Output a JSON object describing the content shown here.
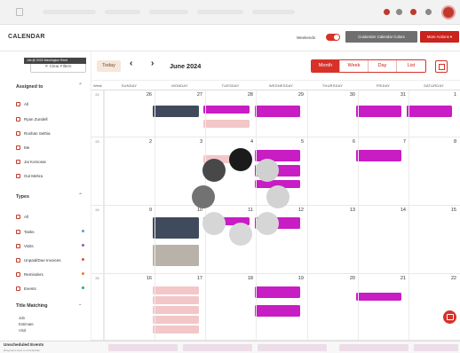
{
  "topbar": {
    "icons": [
      "menu-icon",
      "notification-icon",
      "help-icon",
      "chart-icon",
      "settings-icon",
      "avatar"
    ]
  },
  "header": {
    "title": "CALENDAR",
    "weekends_label": "Weekends",
    "customize_label": "Customize Calendar Colors",
    "more_actions_label": "More Actions ▾"
  },
  "sidebar": {
    "clear_filters": "✕ Clear Filters",
    "assigned_title": "Assigned to",
    "assigned": [
      {
        "label": "All"
      },
      {
        "label": "Ryan Zundell"
      },
      {
        "label": "Roshan Sethia"
      },
      {
        "label": "Me"
      },
      {
        "label": "Jai Komosar"
      },
      {
        "label": "Gul Mehra"
      }
    ],
    "tooltip": "Job @ 2024 Washington Reed",
    "types_title": "Types",
    "types": [
      {
        "label": "All",
        "color": ""
      },
      {
        "label": "Tasks",
        "color": "#4aa3df"
      },
      {
        "label": "Visits",
        "color": "#9b59b6"
      },
      {
        "label": "Unpaid/Due Invoices",
        "color": "#e74c3c"
      },
      {
        "label": "Reminders",
        "color": "#e67e22"
      },
      {
        "label": "Events",
        "color": "#27ae60"
      }
    ],
    "title_matching_title": "Title Matching",
    "title_matching": [
      "Job",
      "Estimate",
      "Visit"
    ]
  },
  "toolbar": {
    "today": "Today",
    "prev": "‹",
    "next": "›",
    "month_title": "June 2024",
    "views": [
      {
        "label": "Month",
        "active": true
      },
      {
        "label": "Week",
        "active": false
      },
      {
        "label": "Day",
        "active": false
      },
      {
        "label": "List",
        "active": false
      }
    ]
  },
  "grid": {
    "week_label": "Week",
    "day_names": [
      "SUNDAY",
      "MONDAY",
      "TUESDAY",
      "WEDNESDAY",
      "THURSDAY",
      "FRIDAY",
      "SATURDAY"
    ],
    "weeks": [
      {
        "num": "22",
        "dates": [
          "26",
          "27",
          "28",
          "29",
          "30",
          "31",
          "1"
        ]
      },
      {
        "num": "23",
        "dates": [
          "2",
          "3",
          "4",
          "5",
          "6",
          "7",
          "8"
        ]
      },
      {
        "num": "24",
        "dates": [
          "9",
          "10",
          "11",
          "12",
          "13",
          "14",
          "15"
        ]
      },
      {
        "num": "25",
        "dates": [
          "16",
          "17",
          "18",
          "19",
          "20",
          "21",
          "22"
        ]
      }
    ]
  },
  "bottom": {
    "title": "Unscheduled Events",
    "subtitle": "Drag items here to unschedule"
  },
  "colors": {
    "brand": "#d6322a",
    "magenta": "#c81cc4",
    "dark": "#3f4b5c",
    "pink": "#f3c6c8"
  }
}
